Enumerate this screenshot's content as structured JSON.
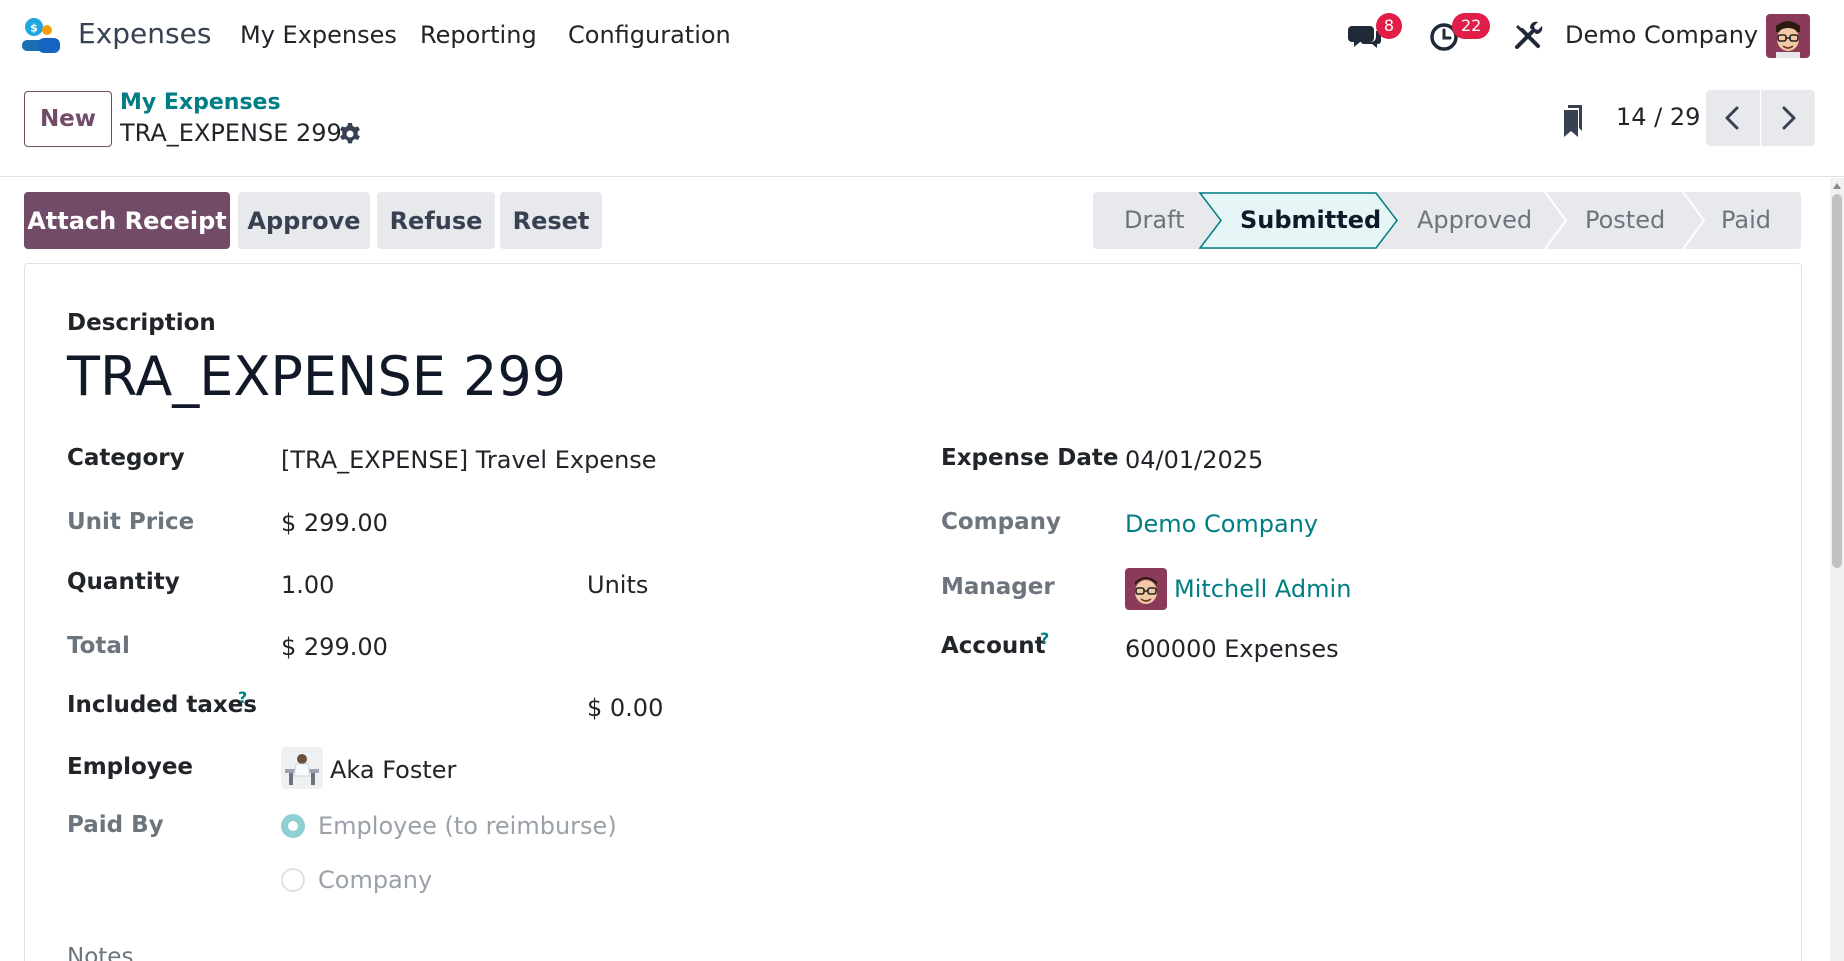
{
  "navbar": {
    "app_name": "Expenses",
    "menu": [
      "My Expenses",
      "Reporting",
      "Configuration"
    ],
    "messages_count": "8",
    "activities_count": "22",
    "company": "Demo Company",
    "icons": {
      "logo": "expenses-app-logo",
      "messages": "chat-icon",
      "activities": "clock-icon",
      "tools": "tools-icon",
      "user": "user-avatar"
    }
  },
  "control_panel": {
    "new_label": "New",
    "breadcrumb_parent": "My Expenses",
    "breadcrumb_current": "TRA_EXPENSE 299",
    "pager": "14 / 29"
  },
  "actions": {
    "attach_receipt": "Attach Receipt",
    "approve": "Approve",
    "refuse": "Refuse",
    "reset": "Reset"
  },
  "stages": {
    "items": [
      "Draft",
      "Submitted",
      "Approved",
      "Posted",
      "Paid"
    ],
    "current": "Submitted"
  },
  "form": {
    "description_label": "Description",
    "description": "TRA_EXPENSE 299",
    "category_label": "Category",
    "category": "[TRA_EXPENSE] Travel Expense",
    "unit_price_label": "Unit Price",
    "unit_price": "$ 299.00",
    "quantity_label": "Quantity",
    "quantity": "1.00",
    "uom": "Units",
    "total_label": "Total",
    "total": "$ 299.00",
    "taxes_label": "Included taxes",
    "taxes": "$ 0.00",
    "help_mark": "?",
    "employee_label": "Employee",
    "employee": "Aka Foster",
    "paid_by_label": "Paid By",
    "paid_by_options": [
      "Employee (to reimburse)",
      "Company"
    ],
    "paid_by_selected": "Employee (to reimburse)",
    "notes_label": "Notes",
    "expense_date_label": "Expense Date",
    "expense_date": "04/01/2025",
    "company_label": "Company",
    "company": "Demo Company",
    "manager_label": "Manager",
    "manager": "Mitchell Admin",
    "account_label": "Account",
    "account": "600000 Expenses"
  },
  "colors": {
    "brand": "#714b67",
    "link": "#017e84",
    "badge": "#e11d48",
    "stage_active_bg": "#e6f6f6"
  }
}
